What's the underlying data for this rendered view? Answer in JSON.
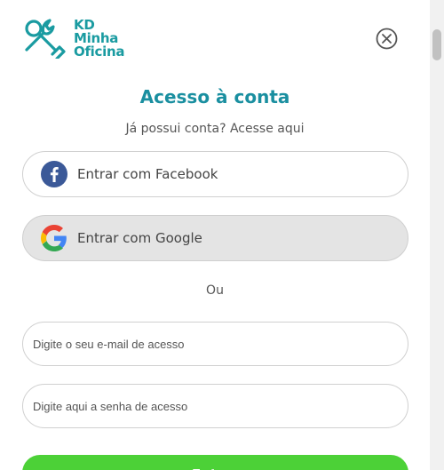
{
  "logo": {
    "line1": "KD",
    "line2": "Minha",
    "line3": "Oficina"
  },
  "close": {
    "icon": "close-circle-icon"
  },
  "title": "Acesso à conta",
  "subtitle": "Já possui conta? Acesse aqui",
  "social": {
    "facebook": {
      "label": "Entrar com Facebook",
      "icon": "facebook-icon",
      "color": "#3b5998"
    },
    "google": {
      "label": "Entrar com Google",
      "icon": "google-icon"
    }
  },
  "divider": "Ou",
  "form": {
    "email": {
      "placeholder": "Digite o seu e-mail de acesso",
      "value": ""
    },
    "password": {
      "placeholder": "Digite aqui a senha de acesso",
      "value": ""
    },
    "submit_label": "Entrar"
  },
  "colors": {
    "brand": "#1a9ba1",
    "title": "#1a8fa0",
    "submit": "#4cd137"
  }
}
